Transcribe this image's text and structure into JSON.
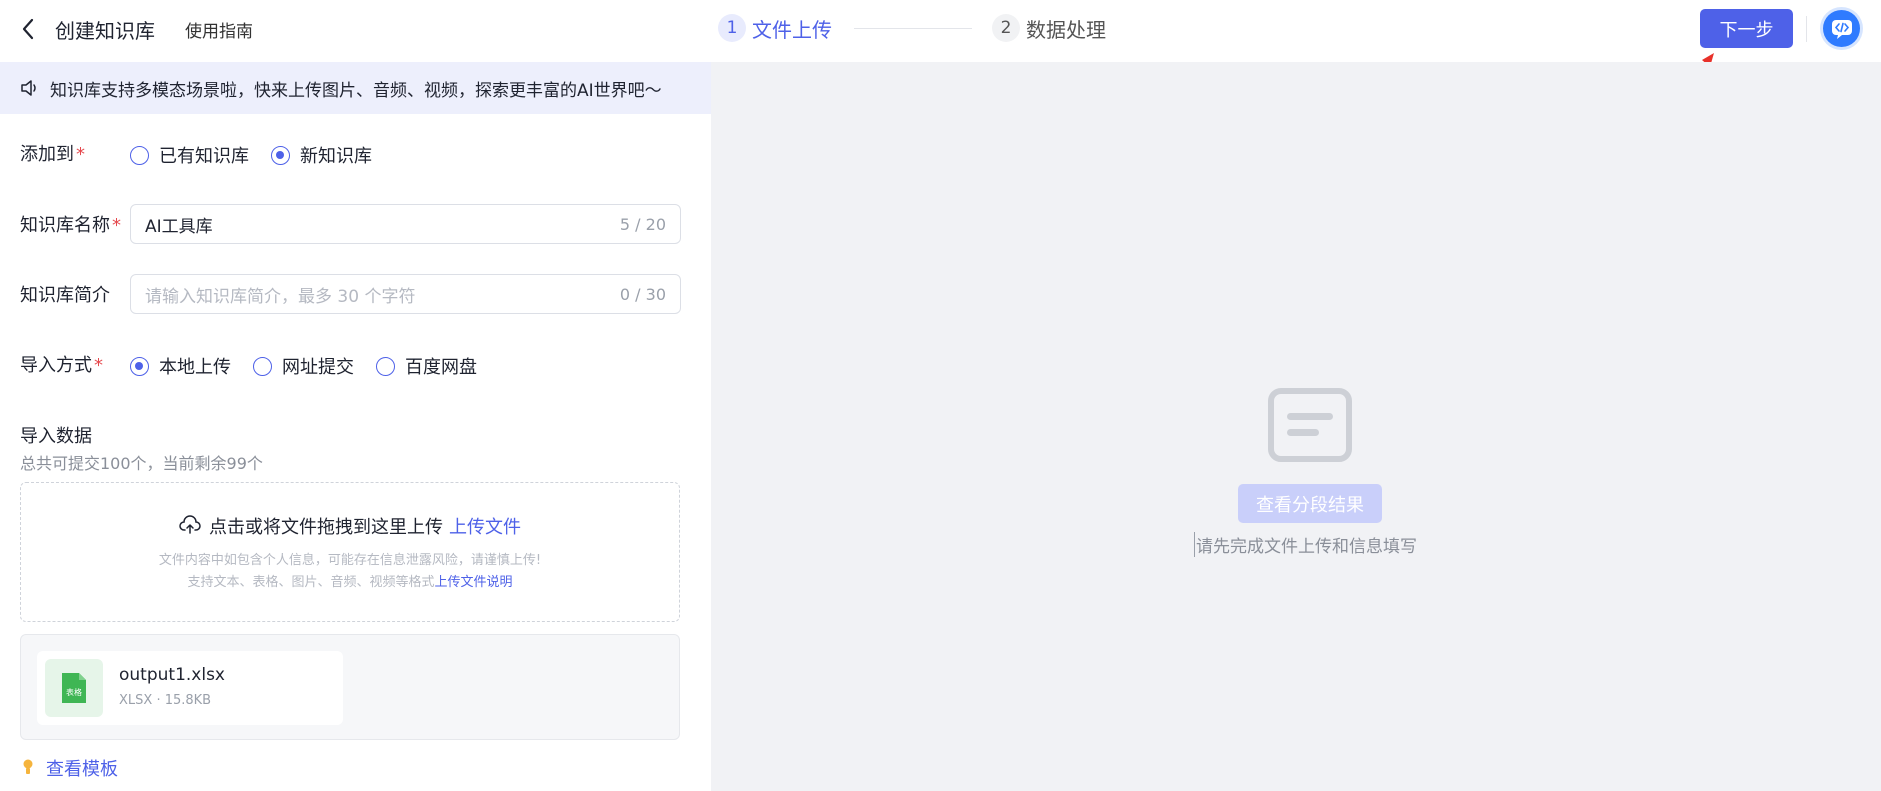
{
  "header": {
    "title": "创建知识库",
    "guide_label": "使用指南",
    "steps": [
      {
        "num": "1",
        "label": "文件上传"
      },
      {
        "num": "2",
        "label": "数据处理"
      }
    ],
    "next_label": "下一步"
  },
  "notice": {
    "text": "知识库支持多模态场景啦，快来上传图片、音频、视频，探索更丰富的AI世界吧～"
  },
  "form": {
    "add_to": {
      "label": "添加到",
      "options": [
        "已有知识库",
        "新知识库"
      ],
      "selected": "新知识库"
    },
    "name": {
      "label": "知识库名称",
      "value": "AI工具库",
      "counter": "5 / 20"
    },
    "intro": {
      "label": "知识库简介",
      "placeholder": "请输入知识库简介，最多 30  个字符",
      "counter": "0 / 30"
    },
    "import_method": {
      "label": "导入方式",
      "options": [
        "本地上传",
        "网址提交",
        "百度网盘"
      ],
      "selected": "本地上传"
    }
  },
  "import_data": {
    "title": "导入数据",
    "subtitle": "总共可提交100个，当前剩余99个",
    "dropzone": {
      "main_text": "点击或将文件拖拽到这里上传",
      "link_text": "上传文件",
      "hint1": "文件内容中如包含个人信息，可能存在信息泄露风险，请谨慎上传!",
      "hint2": "支持文本、表格、图片、音频、视频等格式",
      "hint2_link": "上传文件说明"
    },
    "files": [
      {
        "name": "output1.xlsx",
        "meta": "XLSX · 15.8KB",
        "icon_label": "表格"
      }
    ],
    "template_link": "查看模板"
  },
  "preview": {
    "button_label": "查看分段结果",
    "hint": "请先完成文件上传和信息填写"
  },
  "colors": {
    "accent": "#4e61e8",
    "file_green": "#3fb654"
  }
}
